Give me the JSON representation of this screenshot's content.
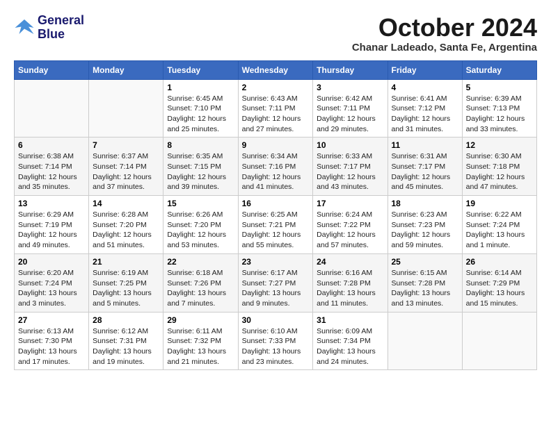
{
  "logo": {
    "line1": "General",
    "line2": "Blue"
  },
  "title": "October 2024",
  "location": "Chanar Ladeado, Santa Fe, Argentina",
  "weekdays": [
    "Sunday",
    "Monday",
    "Tuesday",
    "Wednesday",
    "Thursday",
    "Friday",
    "Saturday"
  ],
  "weeks": [
    [
      {
        "day": "",
        "info": ""
      },
      {
        "day": "",
        "info": ""
      },
      {
        "day": "1",
        "info": "Sunrise: 6:45 AM\nSunset: 7:10 PM\nDaylight: 12 hours\nand 25 minutes."
      },
      {
        "day": "2",
        "info": "Sunrise: 6:43 AM\nSunset: 7:11 PM\nDaylight: 12 hours\nand 27 minutes."
      },
      {
        "day": "3",
        "info": "Sunrise: 6:42 AM\nSunset: 7:11 PM\nDaylight: 12 hours\nand 29 minutes."
      },
      {
        "day": "4",
        "info": "Sunrise: 6:41 AM\nSunset: 7:12 PM\nDaylight: 12 hours\nand 31 minutes."
      },
      {
        "day": "5",
        "info": "Sunrise: 6:39 AM\nSunset: 7:13 PM\nDaylight: 12 hours\nand 33 minutes."
      }
    ],
    [
      {
        "day": "6",
        "info": "Sunrise: 6:38 AM\nSunset: 7:14 PM\nDaylight: 12 hours\nand 35 minutes."
      },
      {
        "day": "7",
        "info": "Sunrise: 6:37 AM\nSunset: 7:14 PM\nDaylight: 12 hours\nand 37 minutes."
      },
      {
        "day": "8",
        "info": "Sunrise: 6:35 AM\nSunset: 7:15 PM\nDaylight: 12 hours\nand 39 minutes."
      },
      {
        "day": "9",
        "info": "Sunrise: 6:34 AM\nSunset: 7:16 PM\nDaylight: 12 hours\nand 41 minutes."
      },
      {
        "day": "10",
        "info": "Sunrise: 6:33 AM\nSunset: 7:17 PM\nDaylight: 12 hours\nand 43 minutes."
      },
      {
        "day": "11",
        "info": "Sunrise: 6:31 AM\nSunset: 7:17 PM\nDaylight: 12 hours\nand 45 minutes."
      },
      {
        "day": "12",
        "info": "Sunrise: 6:30 AM\nSunset: 7:18 PM\nDaylight: 12 hours\nand 47 minutes."
      }
    ],
    [
      {
        "day": "13",
        "info": "Sunrise: 6:29 AM\nSunset: 7:19 PM\nDaylight: 12 hours\nand 49 minutes."
      },
      {
        "day": "14",
        "info": "Sunrise: 6:28 AM\nSunset: 7:20 PM\nDaylight: 12 hours\nand 51 minutes."
      },
      {
        "day": "15",
        "info": "Sunrise: 6:26 AM\nSunset: 7:20 PM\nDaylight: 12 hours\nand 53 minutes."
      },
      {
        "day": "16",
        "info": "Sunrise: 6:25 AM\nSunset: 7:21 PM\nDaylight: 12 hours\nand 55 minutes."
      },
      {
        "day": "17",
        "info": "Sunrise: 6:24 AM\nSunset: 7:22 PM\nDaylight: 12 hours\nand 57 minutes."
      },
      {
        "day": "18",
        "info": "Sunrise: 6:23 AM\nSunset: 7:23 PM\nDaylight: 12 hours\nand 59 minutes."
      },
      {
        "day": "19",
        "info": "Sunrise: 6:22 AM\nSunset: 7:24 PM\nDaylight: 13 hours\nand 1 minute."
      }
    ],
    [
      {
        "day": "20",
        "info": "Sunrise: 6:20 AM\nSunset: 7:24 PM\nDaylight: 13 hours\nand 3 minutes."
      },
      {
        "day": "21",
        "info": "Sunrise: 6:19 AM\nSunset: 7:25 PM\nDaylight: 13 hours\nand 5 minutes."
      },
      {
        "day": "22",
        "info": "Sunrise: 6:18 AM\nSunset: 7:26 PM\nDaylight: 13 hours\nand 7 minutes."
      },
      {
        "day": "23",
        "info": "Sunrise: 6:17 AM\nSunset: 7:27 PM\nDaylight: 13 hours\nand 9 minutes."
      },
      {
        "day": "24",
        "info": "Sunrise: 6:16 AM\nSunset: 7:28 PM\nDaylight: 13 hours\nand 11 minutes."
      },
      {
        "day": "25",
        "info": "Sunrise: 6:15 AM\nSunset: 7:28 PM\nDaylight: 13 hours\nand 13 minutes."
      },
      {
        "day": "26",
        "info": "Sunrise: 6:14 AM\nSunset: 7:29 PM\nDaylight: 13 hours\nand 15 minutes."
      }
    ],
    [
      {
        "day": "27",
        "info": "Sunrise: 6:13 AM\nSunset: 7:30 PM\nDaylight: 13 hours\nand 17 minutes."
      },
      {
        "day": "28",
        "info": "Sunrise: 6:12 AM\nSunset: 7:31 PM\nDaylight: 13 hours\nand 19 minutes."
      },
      {
        "day": "29",
        "info": "Sunrise: 6:11 AM\nSunset: 7:32 PM\nDaylight: 13 hours\nand 21 minutes."
      },
      {
        "day": "30",
        "info": "Sunrise: 6:10 AM\nSunset: 7:33 PM\nDaylight: 13 hours\nand 23 minutes."
      },
      {
        "day": "31",
        "info": "Sunrise: 6:09 AM\nSunset: 7:34 PM\nDaylight: 13 hours\nand 24 minutes."
      },
      {
        "day": "",
        "info": ""
      },
      {
        "day": "",
        "info": ""
      }
    ]
  ]
}
